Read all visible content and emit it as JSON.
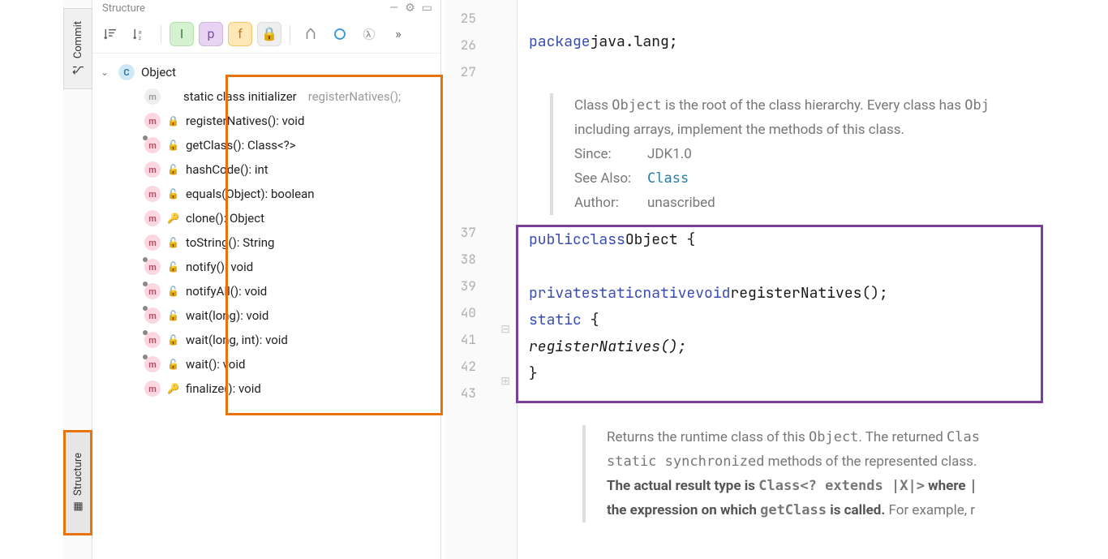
{
  "rail": {
    "commit": "Commit",
    "structure": "Structure"
  },
  "panel": {
    "title": "Structure"
  },
  "toolbar": {
    "sort_type": "↓≡",
    "sort_alpha": "↓ᴬ",
    "more": "»"
  },
  "tree": {
    "root": "Object",
    "items": [
      {
        "icon": "m",
        "final": false,
        "access": "ghost",
        "label": "static class initializer",
        "ghost": "registerNatives();"
      },
      {
        "icon": "m",
        "final": false,
        "access": "lock",
        "label": "registerNatives(): void"
      },
      {
        "icon": "m",
        "final": true,
        "access": "pub",
        "label": "getClass(): Class<?>"
      },
      {
        "icon": "m",
        "final": false,
        "access": "pub",
        "label": "hashCode(): int"
      },
      {
        "icon": "m",
        "final": false,
        "access": "pub",
        "label": "equals(Object): boolean"
      },
      {
        "icon": "m",
        "final": false,
        "access": "prot",
        "label": "clone(): Object"
      },
      {
        "icon": "m",
        "final": false,
        "access": "pub",
        "label": "toString(): String"
      },
      {
        "icon": "m",
        "final": true,
        "access": "pub",
        "label": "notify(): void"
      },
      {
        "icon": "m",
        "final": true,
        "access": "pub",
        "label": "notifyAll(): void"
      },
      {
        "icon": "m",
        "final": true,
        "access": "pub",
        "label": "wait(long): void"
      },
      {
        "icon": "m",
        "final": true,
        "access": "pub",
        "label": "wait(long, int): void"
      },
      {
        "icon": "m",
        "final": true,
        "access": "pub",
        "label": "wait(): void"
      },
      {
        "icon": "m",
        "final": false,
        "access": "prot",
        "label": "finalize(): void"
      }
    ]
  },
  "gutter": {
    "lines": [
      "25",
      "26",
      "27",
      "",
      "",
      "",
      "",
      "",
      "37",
      "38",
      "39",
      "40",
      "41",
      "42",
      "43"
    ]
  },
  "code": {
    "pkg_kw": "package",
    "pkg_name": "java.lang",
    "doc1_line1_a": "Class ",
    "doc1_line1_b": "Object",
    "doc1_line1_c": " is the root of the class hierarchy. Every class has ",
    "doc1_line1_d": "Obj",
    "doc1_line2": "including arrays, implement the methods of this class.",
    "doc1_since_lbl": "Since:",
    "doc1_since_val": "JDK1.0",
    "doc1_seealso_lbl": "See Also:",
    "doc1_seealso_val": "Class",
    "doc1_author_lbl": "Author:",
    "doc1_author_val": "unascribed",
    "decl_public": "public",
    "decl_class": "class",
    "decl_name": "Object",
    "decl_brace": " {",
    "reg_private": "private",
    "reg_static": "static",
    "reg_native": "native",
    "reg_void": "void",
    "reg_name": "registerNatives",
    "reg_paren": "();",
    "stat_static": "static",
    "stat_brace": " {",
    "stat_call": "registerNatives",
    "stat_call_paren": "();",
    "stat_close": "}",
    "doc2_line1_a": "Returns the runtime class of this ",
    "doc2_line1_b": "Object",
    "doc2_line1_c": ". The returned ",
    "doc2_line1_d": "Clas",
    "doc2_line2_a": "static synchronized",
    "doc2_line2_b": " methods of the represented class.",
    "doc2_line3_a": "The actual result type is ",
    "doc2_line3_b": "Class<? extends |X|>",
    "doc2_line3_c": " where ",
    "doc2_line3_d": "|",
    "doc2_line4_a": "the expression on which ",
    "doc2_line4_b": "getClass",
    "doc2_line4_c": " is called.",
    "doc2_line4_d": " For example, r"
  }
}
